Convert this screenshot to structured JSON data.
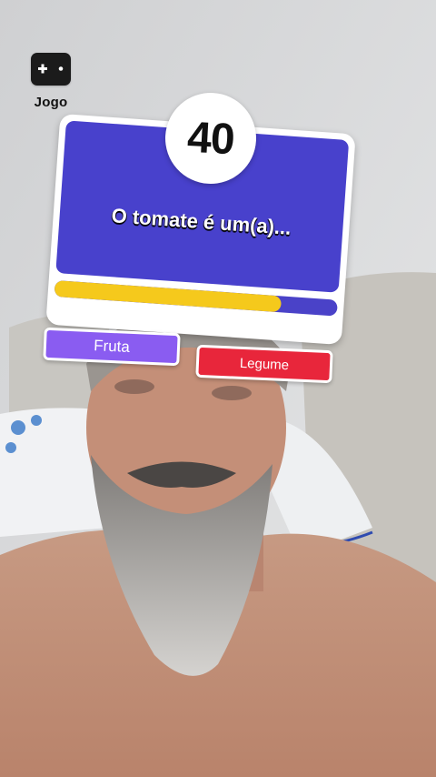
{
  "game_badge": {
    "label": "Jogo",
    "icon": "gamepad-icon"
  },
  "quiz": {
    "score": "40",
    "question": "O tomate é um(a)...",
    "timer_fraction": 0.8,
    "answers": [
      {
        "label": "Fruta",
        "color": "#8a5cf1"
      },
      {
        "label": "Legume",
        "color": "#e8263b"
      }
    ]
  },
  "colors": {
    "card_blue": "#4841cc",
    "timer_yellow": "#f5c91c"
  }
}
